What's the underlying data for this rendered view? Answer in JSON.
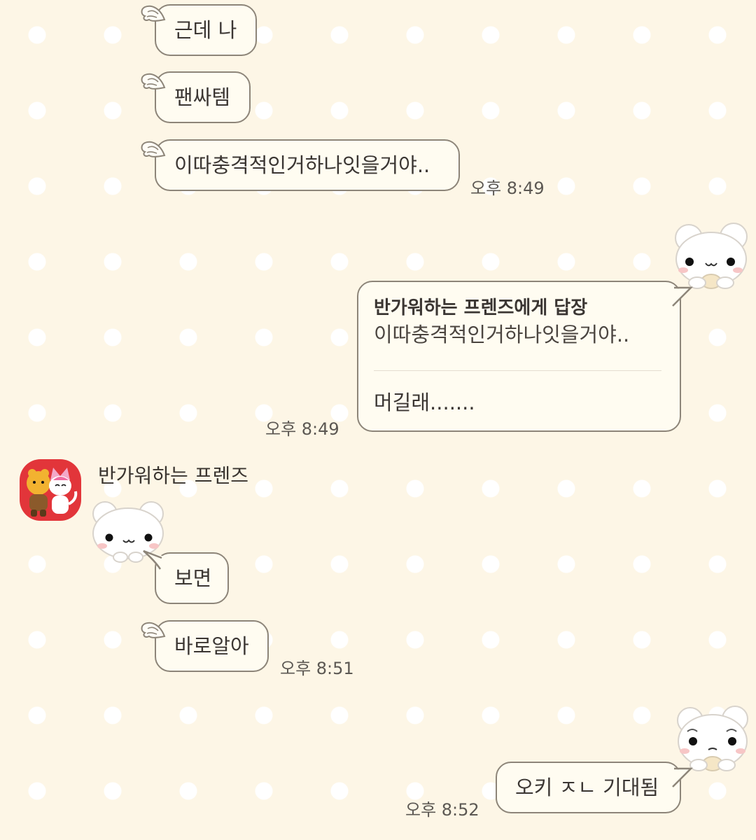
{
  "chat": {
    "sender_name": "반가워하는 프렌즈",
    "messages": {
      "m1": "근데 나",
      "m2": "팬싸템",
      "m3": "이따충격적인거하나잇을거야..",
      "m3_time": "오후 8:49",
      "reply_title": "반가워하는 프렌즈에게 답장",
      "reply_quote": "이따충격적인거하나잇을거야..",
      "reply_text": "머길래.......",
      "reply_time": "오후 8:49",
      "m5": "보면",
      "m6": "바로알아",
      "m6_time": "오후 8:51",
      "m7": "오키 ㅈㄴ 기대됨",
      "m7_time": "오후 8:52"
    }
  },
  "icons": {
    "avatar": "friends-avatar-icon",
    "sticker": "white-bear-sticker",
    "wing": "angel-wing-icon"
  },
  "colors": {
    "background": "#fdf6e6",
    "dot": "#ffffff",
    "bubble_fill": "#fffcf1",
    "bubble_border": "#8d8579",
    "avatar_bg": "#e2353a"
  }
}
